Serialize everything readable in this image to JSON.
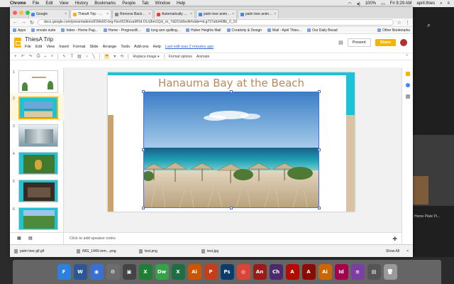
{
  "menubar": {
    "app": "Chrome",
    "items": [
      "File",
      "Edit",
      "View",
      "History",
      "Bookmarks",
      "People",
      "Tab",
      "Window",
      "Help"
    ],
    "battery": "100%",
    "clock": "Fri 9:29 AM",
    "user": "april.thies"
  },
  "tabs": [
    {
      "title": "Google",
      "color": "#4285f4"
    },
    {
      "title": "ThiesA Trip - Google Slides",
      "color": "#f4b400"
    },
    {
      "title": "Remove Background from Ima",
      "color": "#888888"
    },
    {
      "title": "Automatically Remove Backgr",
      "color": "#e94235"
    },
    {
      "title": "palm tree animated gif - Googl",
      "color": "#4285f4"
    },
    {
      "title": "palm tree animated gif - Googl",
      "color": "#4285f4"
    }
  ],
  "url": "docs.google.com/presentation/d/1Me6O-brg-NxxH236xsaMOd-DLiUbm1Qcl_m_7dt2Oz8/edit#slide=id.g737a5d408b_0_10",
  "bookmarks": [
    "Apps",
    "envato suite",
    "Index - Home Pag...",
    "Home - ProgressB...",
    "long arm quilting...",
    "Huber Heights Mail",
    "Creativity & Design",
    "Mail - April Thies...",
    "Our Daily Bread"
  ],
  "bookmarks_other": "Other Bookmarks",
  "doc": {
    "title": "ThiesA Trip",
    "menus": [
      "File",
      "Edit",
      "View",
      "Insert",
      "Format",
      "Slide",
      "Arrange",
      "Tools",
      "Add-ons",
      "Help"
    ],
    "last_edit": "Last edit was 2 minutes ago",
    "present": "Present",
    "share": "Share"
  },
  "toolbar": {
    "replace_image": "Replace image ▾",
    "format_options": "Format options",
    "animate": "Animate"
  },
  "slides": [
    {
      "num": "1"
    },
    {
      "num": "2"
    },
    {
      "num": "3"
    },
    {
      "num": "4"
    },
    {
      "num": "5"
    },
    {
      "num": "6"
    }
  ],
  "slide": {
    "title": "Hanauma Bay at the Beach"
  },
  "notes_placeholder": "Click to add speaker notes",
  "downloads": [
    {
      "name": "palm tree gif.gif"
    },
    {
      "name": "IMG_1440-rem....png"
    },
    {
      "name": "test.png"
    },
    {
      "name": "test.jpg"
    }
  ],
  "downloads_showall": "Show All",
  "right_app_label": "Home Plate Pi...",
  "dock": [
    {
      "label": "F",
      "color": "#2f7fe0",
      "name": "finder-icon"
    },
    {
      "label": "W",
      "color": "#2b5797",
      "name": "word-icon"
    },
    {
      "label": "◉",
      "color": "#3b6fd0",
      "name": "safari-icon"
    },
    {
      "label": "⚙",
      "color": "#6d6d6d",
      "name": "system-preferences-icon"
    },
    {
      "label": "▣",
      "color": "#444444",
      "name": "photo-booth-icon"
    },
    {
      "label": "X",
      "color": "#1e7e34",
      "name": "x-app-icon"
    },
    {
      "label": "Dw",
      "color": "#35a24a",
      "name": "dreamweaver-icon"
    },
    {
      "label": "X",
      "color": "#1d6f42",
      "name": "excel-icon"
    },
    {
      "label": "Ai",
      "color": "#cc5500",
      "name": "illustrator-icon"
    },
    {
      "label": "P",
      "color": "#c43e1c",
      "name": "powerpoint-icon"
    },
    {
      "label": "Ps",
      "color": "#0a3d6b",
      "name": "photoshop-icon"
    },
    {
      "label": "◎",
      "color": "#db4437",
      "name": "chrome-icon"
    },
    {
      "label": "An",
      "color": "#9b1b1b",
      "name": "animate-icon"
    },
    {
      "label": "Ch",
      "color": "#4b2a6e",
      "name": "character-animator-icon"
    },
    {
      "label": "A",
      "color": "#b30b00",
      "name": "acrobat-icon"
    },
    {
      "label": "A",
      "color": "#8b0b00",
      "name": "acrobat-distiller-icon"
    },
    {
      "label": "Ai",
      "color": "#cc6600",
      "name": "illustrator-2-icon"
    },
    {
      "label": "Id",
      "color": "#a3004e",
      "name": "indesign-icon"
    },
    {
      "label": "≡",
      "color": "#7a3fa0",
      "name": "app-icon"
    },
    {
      "label": "▤",
      "color": "#555555",
      "name": "downloads-stack-icon"
    },
    {
      "label": "🗑",
      "color": "#9a9a9a",
      "name": "trash-icon"
    }
  ]
}
